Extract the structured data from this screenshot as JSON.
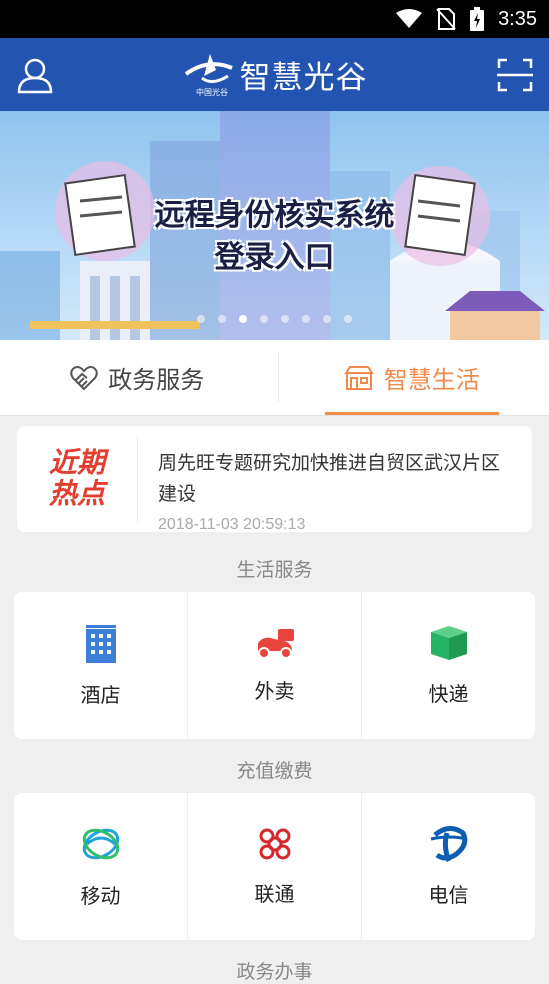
{
  "statusbar": {
    "time": "3:35"
  },
  "appbar": {
    "title": "智慧光谷",
    "logo_text": "中国光谷",
    "icons": {
      "left": "user-icon",
      "right": "scan-icon"
    }
  },
  "banner": {
    "title": "远程身份核实系统",
    "subtitle": "登录入口",
    "page_count": 8,
    "active_page": 3
  },
  "tabs": [
    {
      "label": "政务服务",
      "icon": "heart-hands-icon",
      "active": false
    },
    {
      "label": "智慧生活",
      "icon": "shop-icon",
      "active": true
    }
  ],
  "news": {
    "badge_line1": "近期",
    "badge_line2": "热点",
    "title": "周先旺专题研究加快推进自贸区武汉片区建设",
    "time": "2018-11-03 20:59:13"
  },
  "sections": {
    "life": {
      "title": "生活服务",
      "items": [
        {
          "label": "酒店",
          "icon": "hotel-icon",
          "color": "#3d7fd6"
        },
        {
          "label": "外卖",
          "icon": "delivery-icon",
          "color": "#e9443b"
        },
        {
          "label": "快递",
          "icon": "package-icon",
          "color": "#25b364"
        }
      ]
    },
    "recharge": {
      "title": "充值缴费",
      "items": [
        {
          "label": "移动",
          "icon": "china-mobile-icon",
          "color": "#1ea3d8"
        },
        {
          "label": "联通",
          "icon": "china-unicom-icon",
          "color": "#d7272c"
        },
        {
          "label": "电信",
          "icon": "china-telecom-icon",
          "color": "#0d5eb3"
        }
      ]
    },
    "gov": {
      "title": "政务办事"
    }
  },
  "colors": {
    "brand": "#2354b1",
    "accent": "#f08a4b"
  }
}
